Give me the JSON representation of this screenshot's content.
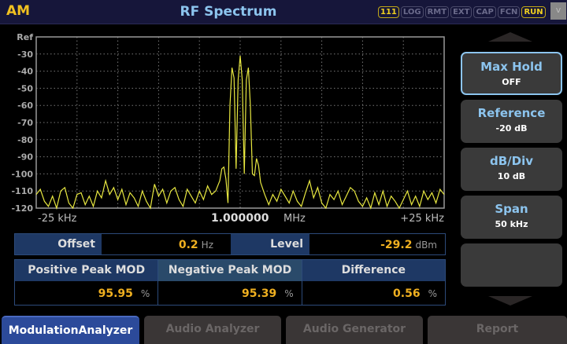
{
  "header": {
    "mode": "AM",
    "title": "RF Spectrum",
    "badges": [
      {
        "label": "111",
        "active": true
      },
      {
        "label": "LOG",
        "active": false
      },
      {
        "label": "RMT",
        "active": false
      },
      {
        "label": "EXT",
        "active": false
      },
      {
        "label": "CAP",
        "active": false
      },
      {
        "label": "FCN",
        "active": false
      },
      {
        "label": "RUN",
        "active": true
      }
    ],
    "menu_glyph": "v"
  },
  "chart_data": {
    "type": "line",
    "trace_color": "#e8e840",
    "ylabels": [
      "Ref",
      "-30",
      "-40",
      "-50",
      "-60",
      "-70",
      "-80",
      "-90",
      "-100",
      "-110",
      "-120"
    ],
    "ylim": [
      -120,
      -20
    ],
    "xlim": [
      -25,
      25
    ],
    "x_unit": "kHz",
    "xlabel_left": "-25 kHz",
    "xlabel_center": "1.000000",
    "xlabel_center_unit": "MHz",
    "xlabel_right": "+25 kHz",
    "grid": true,
    "points": [
      [
        -25,
        -112
      ],
      [
        -24.5,
        -109
      ],
      [
        -24,
        -116
      ],
      [
        -23.5,
        -119
      ],
      [
        -23,
        -113
      ],
      [
        -22.5,
        -120
      ],
      [
        -22,
        -110
      ],
      [
        -21.5,
        -108
      ],
      [
        -21,
        -117
      ],
      [
        -20.5,
        -120
      ],
      [
        -20,
        -112
      ],
      [
        -19.5,
        -111
      ],
      [
        -19,
        -118
      ],
      [
        -18.5,
        -113
      ],
      [
        -18,
        -119
      ],
      [
        -17.5,
        -110
      ],
      [
        -17,
        -114
      ],
      [
        -16.5,
        -104
      ],
      [
        -16,
        -112
      ],
      [
        -15.5,
        -108
      ],
      [
        -15,
        -115
      ],
      [
        -14.5,
        -109
      ],
      [
        -14,
        -118
      ],
      [
        -13.5,
        -111
      ],
      [
        -13,
        -114
      ],
      [
        -12.5,
        -119
      ],
      [
        -12,
        -110
      ],
      [
        -11.5,
        -116
      ],
      [
        -11,
        -120
      ],
      [
        -10.5,
        -106
      ],
      [
        -10,
        -113
      ],
      [
        -9.5,
        -109
      ],
      [
        -9,
        -117
      ],
      [
        -8.5,
        -110
      ],
      [
        -8,
        -108
      ],
      [
        -7.5,
        -115
      ],
      [
        -7,
        -119
      ],
      [
        -6.5,
        -109
      ],
      [
        -6,
        -113
      ],
      [
        -5.5,
        -117
      ],
      [
        -5,
        -110
      ],
      [
        -4.5,
        -115
      ],
      [
        -4,
        -107
      ],
      [
        -3.5,
        -112
      ],
      [
        -3,
        -110
      ],
      [
        -2.5,
        -104
      ],
      [
        -2.25,
        -97
      ],
      [
        -2,
        -96
      ],
      [
        -1.75,
        -103
      ],
      [
        -1.5,
        -117
      ],
      [
        -1.25,
        -60
      ],
      [
        -1,
        -38
      ],
      [
        -0.75,
        -44
      ],
      [
        -0.5,
        -97
      ],
      [
        -0.25,
        -45
      ],
      [
        0,
        -31
      ],
      [
        0.25,
        -45
      ],
      [
        0.5,
        -100
      ],
      [
        0.75,
        -45
      ],
      [
        1,
        -38
      ],
      [
        1.25,
        -60
      ],
      [
        1.5,
        -100
      ],
      [
        1.75,
        -101
      ],
      [
        2,
        -91
      ],
      [
        2.25,
        -95
      ],
      [
        2.5,
        -105
      ],
      [
        3,
        -112
      ],
      [
        3.5,
        -118
      ],
      [
        4,
        -112
      ],
      [
        4.5,
        -116
      ],
      [
        5,
        -109
      ],
      [
        5.5,
        -113
      ],
      [
        6,
        -117
      ],
      [
        6.5,
        -110
      ],
      [
        7,
        -116
      ],
      [
        7.5,
        -119
      ],
      [
        8,
        -111
      ],
      [
        8.5,
        -104
      ],
      [
        9,
        -114
      ],
      [
        9.5,
        -108
      ],
      [
        10,
        -117
      ],
      [
        10.5,
        -120
      ],
      [
        11,
        -112
      ],
      [
        11.5,
        -115
      ],
      [
        12,
        -110
      ],
      [
        12.5,
        -118
      ],
      [
        13,
        -113
      ],
      [
        13.5,
        -108
      ],
      [
        14,
        -110
      ],
      [
        14.5,
        -116
      ],
      [
        15,
        -119
      ],
      [
        15.5,
        -114
      ],
      [
        16,
        -120
      ],
      [
        16.5,
        -111
      ],
      [
        17,
        -118
      ],
      [
        17.5,
        -110
      ],
      [
        18,
        -119
      ],
      [
        18.5,
        -113
      ],
      [
        19,
        -116
      ],
      [
        19.5,
        -120
      ],
      [
        20,
        -115
      ],
      [
        20.5,
        -110
      ],
      [
        21,
        -118
      ],
      [
        21.5,
        -113
      ],
      [
        22,
        -119
      ],
      [
        22.5,
        -110
      ],
      [
        23,
        -115
      ],
      [
        23.5,
        -111
      ],
      [
        24,
        -117
      ],
      [
        24.5,
        -109
      ],
      [
        25,
        -112
      ]
    ]
  },
  "side": {
    "buttons": [
      {
        "title": "Max Hold",
        "value": "OFF",
        "selected": true
      },
      {
        "title": "Reference",
        "value": "-20 dB"
      },
      {
        "title": "dB/Div",
        "value": "10 dB"
      },
      {
        "title": "Span",
        "value": "50 kHz"
      },
      {
        "title": "",
        "value": ""
      }
    ]
  },
  "info": {
    "offset_label": "Offset",
    "offset_value": "0.2",
    "offset_unit": "Hz",
    "level_label": "Level",
    "level_value": "-29.2",
    "level_unit": "dBm",
    "columns": [
      {
        "header": "Positive Peak MOD",
        "value": "95.95",
        "unit": "%"
      },
      {
        "header": "Negative Peak MOD",
        "value": "95.39",
        "unit": "%"
      },
      {
        "header": "Difference",
        "value": "0.56",
        "unit": "%"
      }
    ]
  },
  "tabs": [
    {
      "label": "ModulationAnalyzer",
      "active": true
    },
    {
      "label": "Audio Analyzer"
    },
    {
      "label": "Audio Generator"
    },
    {
      "label": "Report"
    }
  ]
}
